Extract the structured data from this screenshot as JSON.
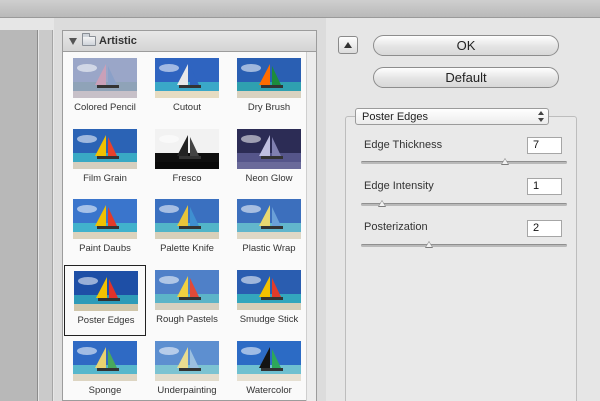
{
  "gallery": {
    "category": "Artistic",
    "selected": "Poster Edges",
    "filters": [
      {
        "label": "Colored Pencil",
        "style": "pencil"
      },
      {
        "label": "Cutout",
        "style": "cutout"
      },
      {
        "label": "Dry Brush",
        "style": "drybrush"
      },
      {
        "label": "Film Grain",
        "style": "filmgrain"
      },
      {
        "label": "Fresco",
        "style": "fresco"
      },
      {
        "label": "Neon Glow",
        "style": "neon"
      },
      {
        "label": "Paint Daubs",
        "style": "daubs"
      },
      {
        "label": "Palette Knife",
        "style": "knife"
      },
      {
        "label": "Plastic Wrap",
        "style": "plastic"
      },
      {
        "label": "Poster Edges",
        "style": "poster"
      },
      {
        "label": "Rough Pastels",
        "style": "pastels"
      },
      {
        "label": "Smudge Stick",
        "style": "smudge"
      },
      {
        "label": "Sponge",
        "style": "sponge"
      },
      {
        "label": "Underpainting",
        "style": "under"
      },
      {
        "label": "Watercolor",
        "style": "water"
      }
    ]
  },
  "buttons": {
    "ok": "OK",
    "default": "Default"
  },
  "settings": {
    "filter_name": "Poster Edges",
    "params": [
      {
        "label": "Edge Thickness",
        "value": "7",
        "level": 0.7
      },
      {
        "label": "Edge Intensity",
        "value": "1",
        "level": 0.1
      },
      {
        "label": "Posterization",
        "value": "2",
        "level": 0.33
      }
    ]
  }
}
